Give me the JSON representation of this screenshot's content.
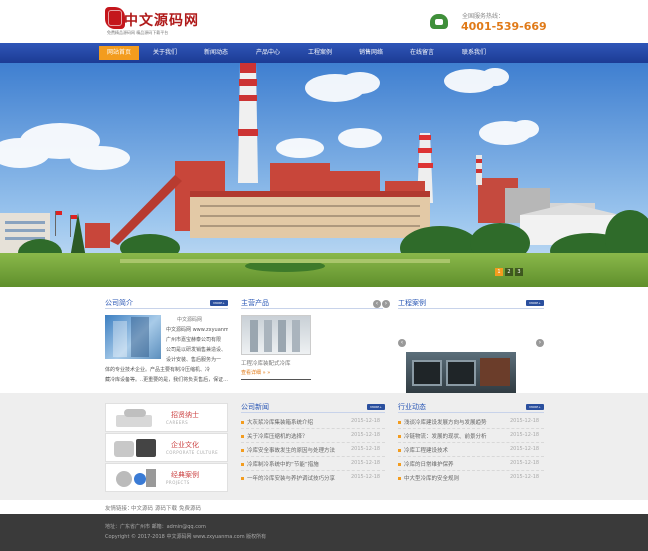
{
  "header": {
    "logo_title": "中文源码网",
    "logo_sub": "免费精品源码网 精品源码下载平台",
    "hotline_label": "全国服务热线：",
    "hotline_number": "4001-539-669"
  },
  "nav": {
    "items": [
      "网站首页",
      "关于我们",
      "新闻动态",
      "产品中心",
      "工程案例",
      "销售网络",
      "在线留言",
      "联系我们"
    ],
    "active_index": 0
  },
  "banner": {
    "dots": [
      "1",
      "2",
      "3"
    ],
    "active_dot": 0
  },
  "about": {
    "title": "公司简介",
    "more": "MORE+",
    "heading": "中文源码网",
    "lines": [
      "中文源码网 www.zxyuanma.com",
      "广州市嘉宝赫泰公司有限",
      "公司是以研发销售兼造设、",
      "设计安装、售后服务为一",
      "体的专业技术企业。产品主要有制冷压缩机、冷",
      "藏冷库设备等。..更重要的是，我们将负责售后，保证..."
    ]
  },
  "products": {
    "title": "主营产品",
    "prev": "‹",
    "next": "›",
    "caption": "工程冷库装配式冷库",
    "more": "查看详细 » »"
  },
  "cases": {
    "title": "工程案例",
    "more": "MORE+",
    "prev": "‹",
    "next": "›"
  },
  "side_links": [
    {
      "title": "招贤纳士",
      "sub": "CAREERS"
    },
    {
      "title": "企业文化",
      "sub": "CORPORATE CULTURE"
    },
    {
      "title": "经典案例",
      "sub": "PROJECTS"
    }
  ],
  "company_news": {
    "title": "公司新闻",
    "more": "MORE+",
    "items": [
      {
        "t": "大灰浆冷库集装箱系统介绍",
        "d": "2015-12-18"
      },
      {
        "t": "关于冷库压缩机的选择？",
        "d": "2015-12-18"
      },
      {
        "t": "冷库安全事故发生的原因与处理方法",
        "d": "2015-12-18"
      },
      {
        "t": "冷库制冷系统中的“节能”措施",
        "d": "2015-12-18"
      },
      {
        "t": "一年的冷库安装与养护调试技巧分享",
        "d": "2015-12-18"
      }
    ]
  },
  "industry_news": {
    "title": "行业动态",
    "more": "MORE+",
    "items": [
      {
        "t": "浅谈冷库建设发展方向与发展趋势",
        "d": "2015-12-18"
      },
      {
        "t": "冷链物流：发展的现状、前景分析",
        "d": "2015-12-18"
      },
      {
        "t": "冷库工程建设技术",
        "d": "2015-12-18"
      },
      {
        "t": "冷库的日常维护保养",
        "d": "2015-12-18"
      },
      {
        "t": "中大型冷库的安全规则",
        "d": "2015-12-18"
      }
    ]
  },
  "links": {
    "label": "友情链接：",
    "items": [
      "中文源码",
      "源码下载",
      "免费源码"
    ]
  },
  "footer": {
    "line1": "地址：广东省广州市  邮箱：admin@qq.com",
    "line2": "Copyright © 2017-2018 中文源码网 www.zxyuanma.com 版权所有"
  },
  "colors": {
    "nav": "#2547a8",
    "accent": "#f39c1e",
    "title_blue": "#2a57b5",
    "hotline": "#e07a18"
  }
}
